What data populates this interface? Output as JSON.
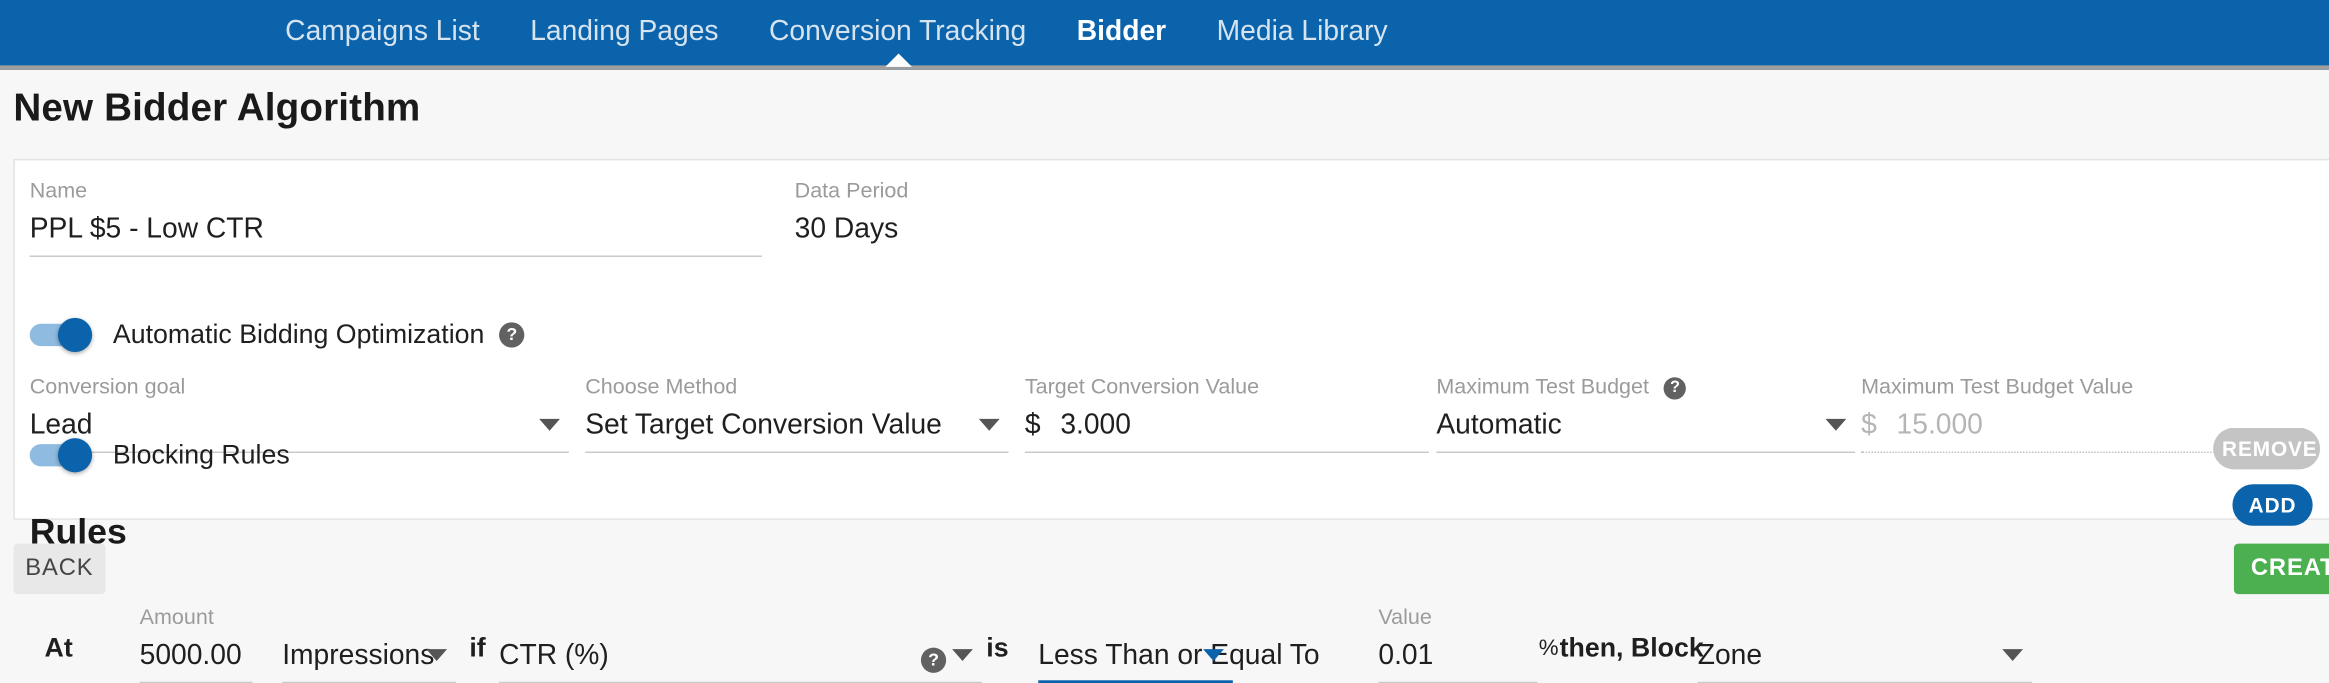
{
  "nav": {
    "items": [
      {
        "label": "Campaigns List",
        "active": false
      },
      {
        "label": "Landing Pages",
        "active": false
      },
      {
        "label": "Conversion Tracking",
        "active": false
      },
      {
        "label": "Bidder",
        "active": true
      },
      {
        "label": "Media Library",
        "active": false
      }
    ]
  },
  "page": {
    "title": "New Bidder Algorithm"
  },
  "form": {
    "name": {
      "label": "Name",
      "value": "PPL $5 - Low CTR"
    },
    "data_period": {
      "label": "Data Period",
      "value": "30 Days"
    },
    "automatic_bidding_optimization": {
      "label": "Automatic Bidding Optimization",
      "enabled": true,
      "help": "?"
    },
    "conversion_goal": {
      "label": "Conversion goal",
      "value": "Lead"
    },
    "choose_method": {
      "label": "Choose Method",
      "value": "Set Target Conversion Value"
    },
    "target_conversion_value": {
      "label": "Target Conversion Value",
      "prefix": "$",
      "value": "3.000"
    },
    "maximum_test_budget": {
      "label": "Maximum Test Budget",
      "value": "Automatic",
      "help": "?"
    },
    "maximum_test_budget_value": {
      "label": "Maximum Test Budget Value",
      "prefix": "$",
      "value": "15.000",
      "disabled": true
    },
    "blocking_rules": {
      "label": "Blocking Rules",
      "enabled": true
    }
  },
  "rules": {
    "heading": "Rules",
    "word_at": "At",
    "word_if": "if",
    "word_is": "is",
    "word_then_block": "then, Block",
    "percent_sign": "%",
    "row": {
      "amount": {
        "label": "Amount",
        "value": "5000.00"
      },
      "unit": {
        "value": "Impressions"
      },
      "metric": {
        "value": "CTR (%)",
        "help": "?"
      },
      "operator": {
        "value": "Less Than or Equal To"
      },
      "value": {
        "label": "Value",
        "value": "0.01"
      },
      "target": {
        "value": "Zone"
      }
    },
    "remove_label": "REMOVE",
    "add_label": "ADD"
  },
  "footer": {
    "back_label": "BACK",
    "create_label": "CREATE"
  },
  "colors": {
    "brand_blue": "#0b63ac",
    "create_green": "#4caf50",
    "disabled_grey": "#c4c4c4"
  }
}
